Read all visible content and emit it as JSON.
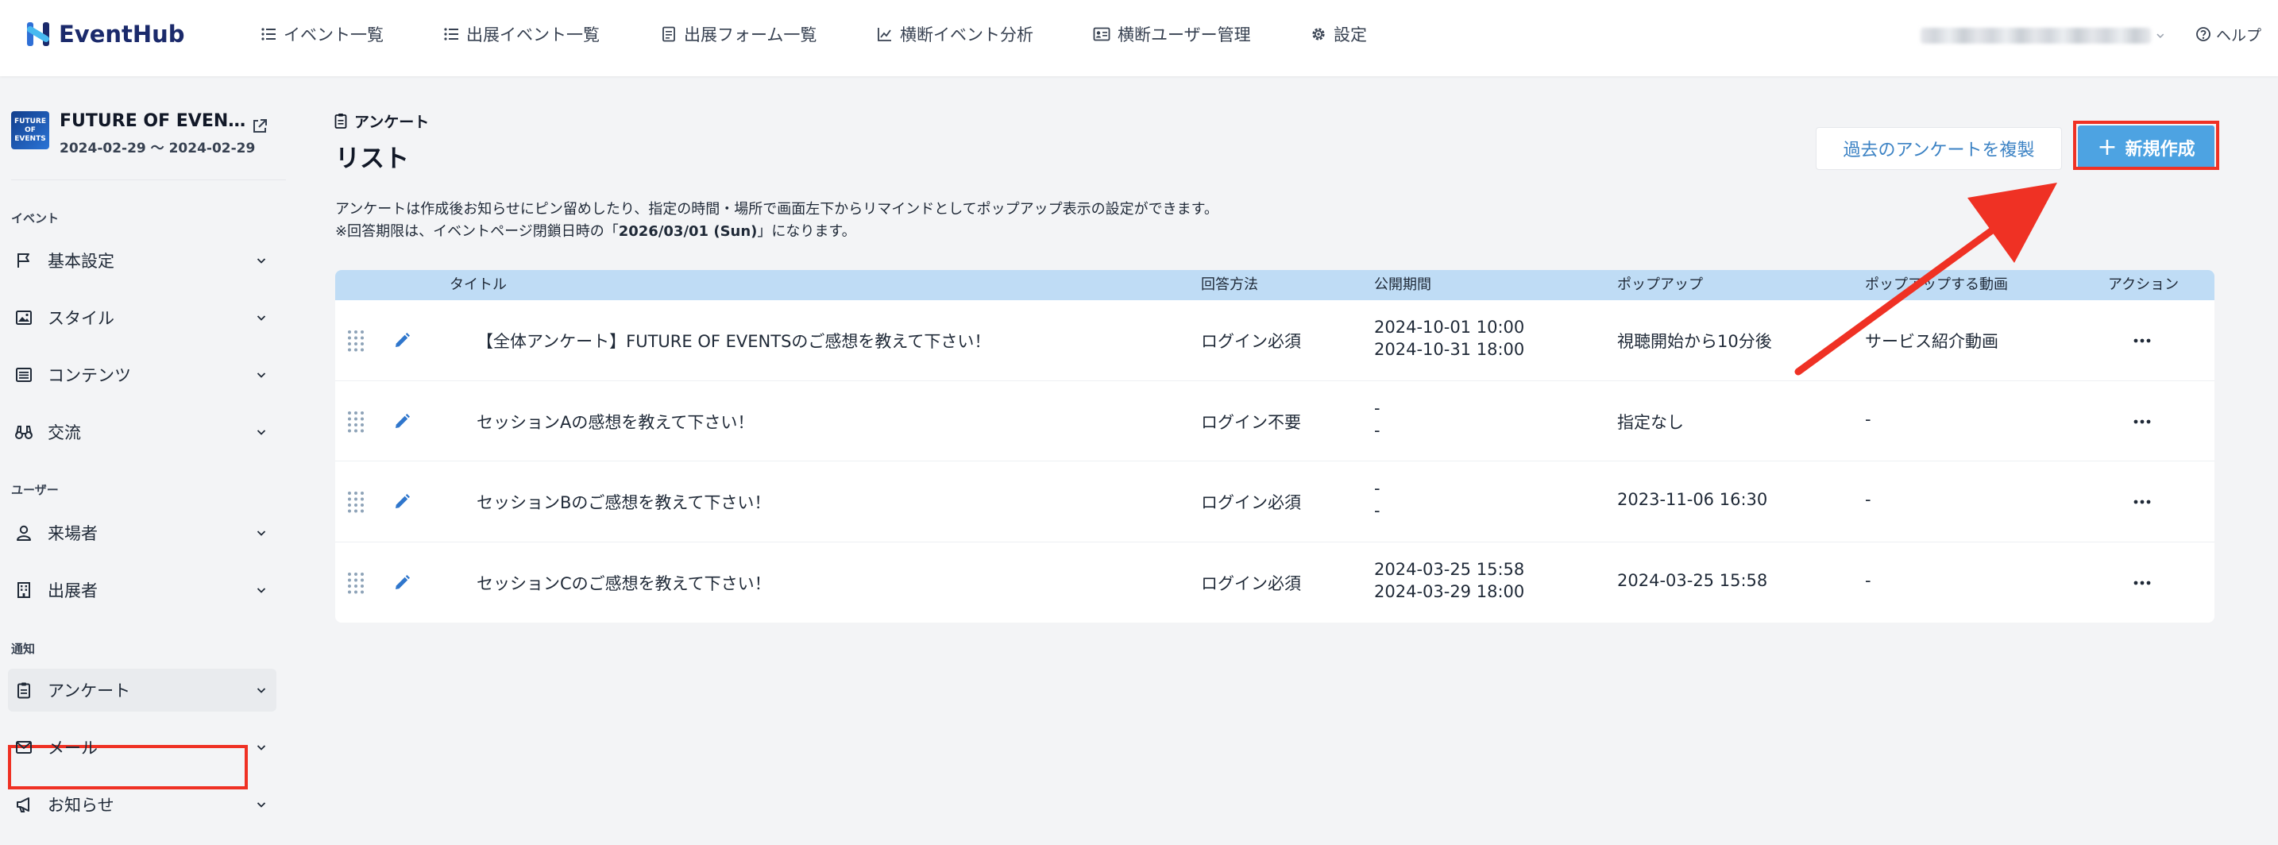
{
  "app": {
    "logo_text": "EventHub",
    "nav": [
      {
        "label": "イベント一覧",
        "icon": "list-icon"
      },
      {
        "label": "出展イベント一覧",
        "icon": "list-icon"
      },
      {
        "label": "出展フォーム一覧",
        "icon": "document-icon"
      },
      {
        "label": "横断イベント分析",
        "icon": "chart-line-icon"
      },
      {
        "label": "横断ユーザー管理",
        "icon": "id-card-icon"
      },
      {
        "label": "設定",
        "icon": "gear-icon"
      }
    ],
    "help_label": "ヘルプ"
  },
  "event": {
    "thumbnail_text": "FUTURE OF EVENTS",
    "name": "FUTURE OF EVENTS",
    "date_range": "2024-02-29 〜 2024-02-29"
  },
  "sidebar": {
    "sections": [
      {
        "title": "イベント",
        "items": [
          {
            "label": "基本設定",
            "icon": "flag-icon"
          },
          {
            "label": "スタイル",
            "icon": "image-icon"
          },
          {
            "label": "コンテンツ",
            "icon": "list-box-icon"
          },
          {
            "label": "交流",
            "icon": "binoculars-icon"
          }
        ]
      },
      {
        "title": "ユーザー",
        "items": [
          {
            "label": "来場者",
            "icon": "user-icon"
          },
          {
            "label": "出展者",
            "icon": "building-icon"
          }
        ]
      },
      {
        "title": "通知",
        "items": [
          {
            "label": "アンケート",
            "icon": "clipboard-icon"
          },
          {
            "label": "メール",
            "icon": "mail-icon"
          },
          {
            "label": "お知らせ",
            "icon": "megaphone-icon"
          }
        ]
      }
    ]
  },
  "main": {
    "breadcrumb": "アンケート",
    "title": "リスト",
    "duplicate_button": "過去のアンケートを複製",
    "new_button": "新規作成",
    "description_line1": "アンケートは作成後お知らせにピン留めしたり、指定の時間・場所で画面左下からリマインドとしてポップアップ表示の設定ができます。",
    "description_line2_prefix": "※回答期限は、イベントページ閉鎖日時の「",
    "description_line2_date": "2026/03/01 (Sun)",
    "description_line2_suffix": "」になります。"
  },
  "table": {
    "headers": {
      "title": "タイトル",
      "answer_method": "回答方法",
      "public_period": "公開期間",
      "popup": "ポップアップ",
      "popup_video": "ポップアップする動画",
      "action": "アクション"
    },
    "rows": [
      {
        "title": "【全体アンケート】FUTURE OF EVENTSのご感想を教えて下さい！",
        "answer_method": "ログイン必須",
        "period_start": "2024-10-01 10:00",
        "period_end": "2024-10-31 18:00",
        "popup": "視聴開始から10分後",
        "popup_video": "サービス紹介動画"
      },
      {
        "title": "セッションAの感想を教えて下さい！",
        "answer_method": "ログイン不要",
        "period_start": "-",
        "period_end": "-",
        "popup": "指定なし",
        "popup_video": "-"
      },
      {
        "title": "セッションBのご感想を教えて下さい！",
        "answer_method": "ログイン必須",
        "period_start": "-",
        "period_end": "-",
        "popup": "2023-11-06 16:30",
        "popup_video": "-"
      },
      {
        "title": "セッションCのご感想を教えて下さい！",
        "answer_method": "ログイン必須",
        "period_start": "2024-03-25 15:58",
        "period_end": "2024-03-29 18:00",
        "popup": "2024-03-25 15:58",
        "popup_video": "-"
      }
    ]
  },
  "colors": {
    "accent": "#4da3e2",
    "header_bg": "#bfdcf5",
    "highlight_red": "#ef3124",
    "logo_navy": "#1b2a6b",
    "link_blue": "#3b82c4"
  }
}
